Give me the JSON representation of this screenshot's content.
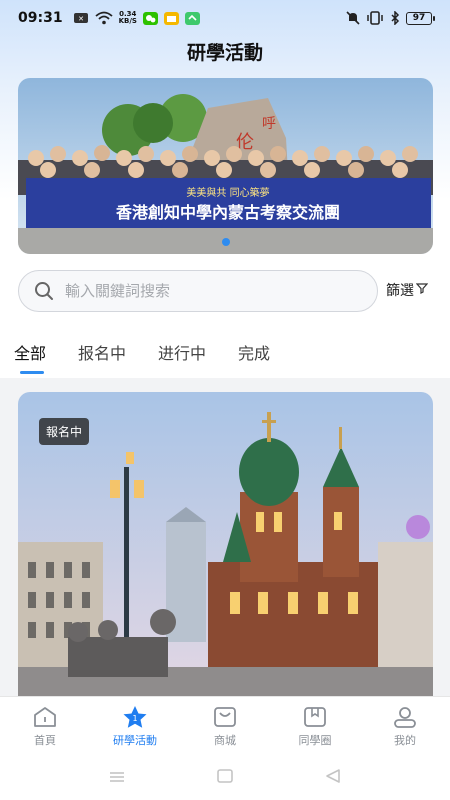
{
  "status_bar": {
    "time": "09:31",
    "net_speed_value": "0.34",
    "net_speed_unit": "KB/S",
    "battery": "97"
  },
  "header": {
    "title": "研學活動"
  },
  "banner": {
    "banner_sign_line1": "美美與共 同心築夢",
    "banner_sign_line2": "香港創知中學內蒙古考察交流團",
    "slide_count": 1,
    "active_slide": 1
  },
  "search": {
    "placeholder": "輸入關鍵詞搜索",
    "value": "",
    "filter_label": "篩選"
  },
  "tabs": [
    {
      "label": "全部",
      "active": true
    },
    {
      "label": "报名中",
      "active": false
    },
    {
      "label": "进行中",
      "active": false
    },
    {
      "label": "完成",
      "active": false
    }
  ],
  "cards": [
    {
      "badge": "報名中",
      "image": "cathedral-photo"
    }
  ],
  "tab_bar": [
    {
      "label": "首頁",
      "icon": "home-icon",
      "active": false
    },
    {
      "label": "研學活動",
      "icon": "star-icon",
      "active": true
    },
    {
      "label": "商城",
      "icon": "shop-bag-icon",
      "active": false
    },
    {
      "label": "同學圈",
      "icon": "bookmark-icon",
      "active": false
    },
    {
      "label": "我的",
      "icon": "profile-icon",
      "active": false
    }
  ],
  "colors": {
    "accent": "#2e8cf0",
    "active_tab_bar": "#1f7df0",
    "inactive": "#8a8f96"
  }
}
